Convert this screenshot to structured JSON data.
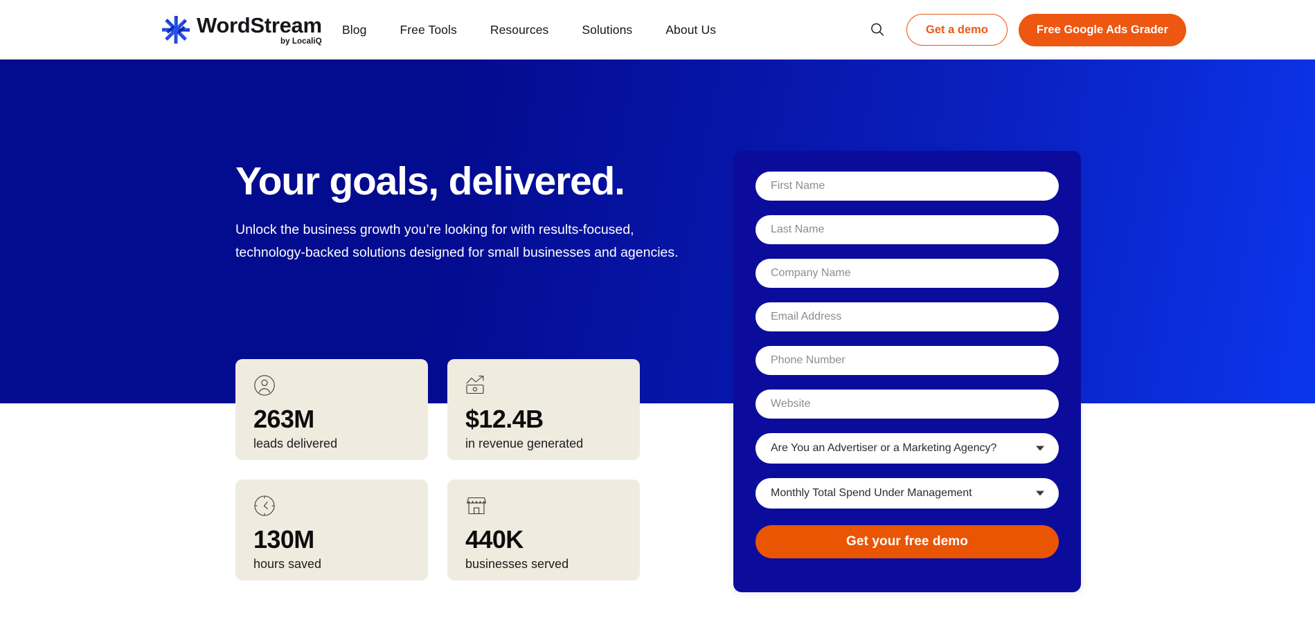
{
  "header": {
    "logo": {
      "icon": "wordstream-asterisk-logo-icon",
      "word": "WordStream",
      "sub": "by LocaliQ"
    },
    "nav_items": [
      {
        "label": "Blog"
      },
      {
        "label": "Free Tools"
      },
      {
        "label": "Resources"
      },
      {
        "label": "Solutions"
      },
      {
        "label": "About Us"
      }
    ],
    "search_icon": "search-icon",
    "demo_button": "Get a demo",
    "grader_button": "Free Google Ads Grader"
  },
  "hero": {
    "title": "Your goals, delivered.",
    "subtitle": "Unlock the business growth you’re looking for with results-focused, technology-backed solutions designed for small businesses and agencies."
  },
  "stats": [
    {
      "icon": "user-circle-icon",
      "value": "263M",
      "label": "leads delivered"
    },
    {
      "icon": "money-trend-icon",
      "value": "$12.4B",
      "label": "in revenue generated"
    },
    {
      "icon": "clock-icon",
      "value": "130M",
      "label": "hours saved"
    },
    {
      "icon": "storefront-icon",
      "value": "440K",
      "label": "businesses served"
    }
  ],
  "form": {
    "fields": [
      {
        "name": "first-name",
        "placeholder": "First Name",
        "value": ""
      },
      {
        "name": "last-name",
        "placeholder": "Last Name",
        "value": ""
      },
      {
        "name": "company-name",
        "placeholder": "Company Name",
        "value": ""
      },
      {
        "name": "email-address",
        "placeholder": "Email Address",
        "value": ""
      },
      {
        "name": "phone-number",
        "placeholder": "Phone Number",
        "value": ""
      },
      {
        "name": "website",
        "placeholder": "Website",
        "value": ""
      }
    ],
    "selects": [
      {
        "name": "advertiser-or-agency",
        "selected": "Are You an Advertiser or a Marketing Agency?"
      },
      {
        "name": "monthly-spend",
        "selected": "Monthly Total Spend Under Management"
      }
    ],
    "submit_label": "Get your free demo"
  },
  "colors": {
    "brand_orange": "#ee5711",
    "submit_orange": "#ea5504",
    "hero_blue_dark": "#030b8f",
    "hero_blue_light": "#0b35ec",
    "form_card_blue": "#0c0c9c",
    "stat_card_cream": "#efebdf",
    "text_dark": "#16161a"
  }
}
